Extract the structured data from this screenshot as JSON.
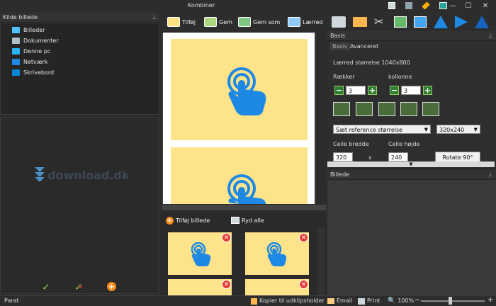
{
  "window": {
    "title": "Kombiner"
  },
  "toolbar": {
    "add_label": "Tilføj",
    "save_label": "Gem",
    "save_as_label": "Gem som",
    "canvas_label": "Lærred"
  },
  "source_panel": {
    "title": "Kilde billede",
    "items": [
      "Billeder",
      "Dokumenter",
      "Denne pc",
      "Netværk",
      "Skrivebord"
    ]
  },
  "watermark": "download.dk",
  "strip": {
    "add_image_label": "Tilføj billede",
    "clear_all_label": "Ryd alle"
  },
  "basis": {
    "title": "Basis",
    "tabs": [
      "Basis",
      "Avanceret"
    ],
    "canvas_size": "Lærred størrelse 1040x800",
    "rows_label": "Rækker",
    "cols_label": "kollonne",
    "rows_value": "3",
    "cols_value": "3",
    "reference_select": "Sæt reference størrelse",
    "size_select": "320x240",
    "cell_width_label": "Celle bredde",
    "cell_height_label": "Celle højde",
    "cell_width_value": "320",
    "cell_height_value": "240",
    "times": "x",
    "rotate_label": "Rotate 90°"
  },
  "image_panel": {
    "title": "Billede"
  },
  "status": {
    "ready": "Parat",
    "copy_clipboard": "Kopier til udklipsholder",
    "email": "Email",
    "print": "Print",
    "zoom": "100%"
  },
  "colors": {
    "thumb_bg": "#fde38a",
    "hand_blue": "#1e88e5",
    "badge_red": "#e53935",
    "app_bg": "#2b2b2b"
  }
}
